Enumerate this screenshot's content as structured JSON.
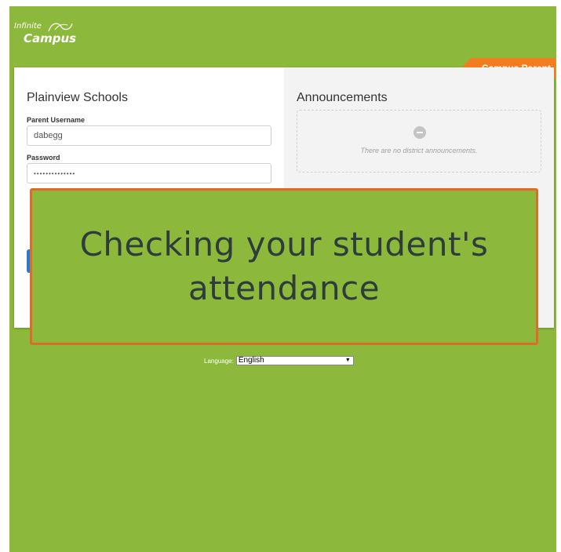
{
  "logo": {
    "line1": "Infinite",
    "line2": "Campus"
  },
  "ribbon": {
    "label": "Campus Parent"
  },
  "login": {
    "school_name": "Plainview Schools",
    "username_label": "Parent Username",
    "username_value": "dabegg",
    "password_label": "Password",
    "password_value": "••••••••••••••"
  },
  "announcements": {
    "title": "Announcements",
    "empty_text": "There are no district announcements."
  },
  "overlay": {
    "line1": "Checking your student's",
    "line2": "attendance"
  },
  "language": {
    "label": "Language:",
    "selected": "English",
    "arrow": "▼"
  },
  "colors": {
    "background": "#8cb83c",
    "ribbon": "#f47b20",
    "overlay_border": "#e0692c",
    "login_button": "#2d7bc4"
  }
}
